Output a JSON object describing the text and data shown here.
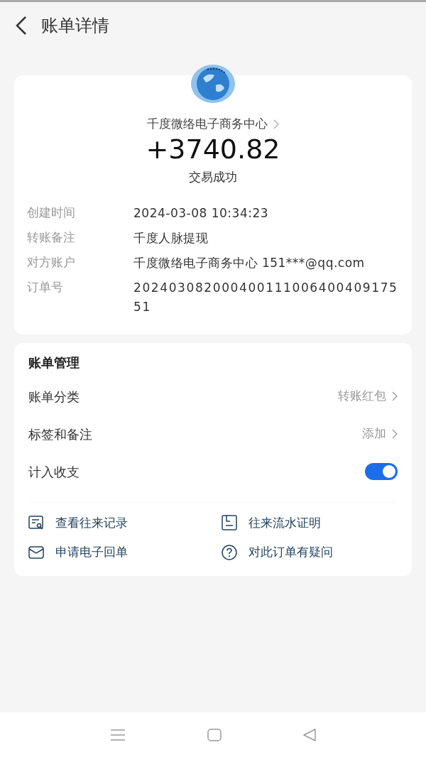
{
  "header": {
    "title": "账单详情"
  },
  "summary": {
    "merchant": "千度微络电子商务中心",
    "amount": "+3740.82",
    "status": "交易成功"
  },
  "details": [
    {
      "label": "创建时间",
      "value": "2024-03-08 10:34:23"
    },
    {
      "label": "转账备注",
      "value": "千度人脉提现"
    },
    {
      "label": "对方账户",
      "value": "千度微络电子商务中心 151***@qq.com"
    },
    {
      "label": "订单号",
      "value": "20240308200040011100640040917551"
    }
  ],
  "management": {
    "title": "账单管理",
    "rows": [
      {
        "kind": "link",
        "label": "账单分类",
        "value": "转账红包"
      },
      {
        "kind": "link",
        "label": "标签和备注",
        "value": "添加"
      },
      {
        "kind": "toggle",
        "label": "计入收支",
        "on": true
      }
    ],
    "actions": [
      {
        "kind": "records",
        "label": "查看往来记录"
      },
      {
        "kind": "statement",
        "label": "往来流水证明"
      },
      {
        "kind": "mail",
        "label": "申请电子回单"
      },
      {
        "kind": "question",
        "label": "对此订单有疑问"
      }
    ]
  }
}
